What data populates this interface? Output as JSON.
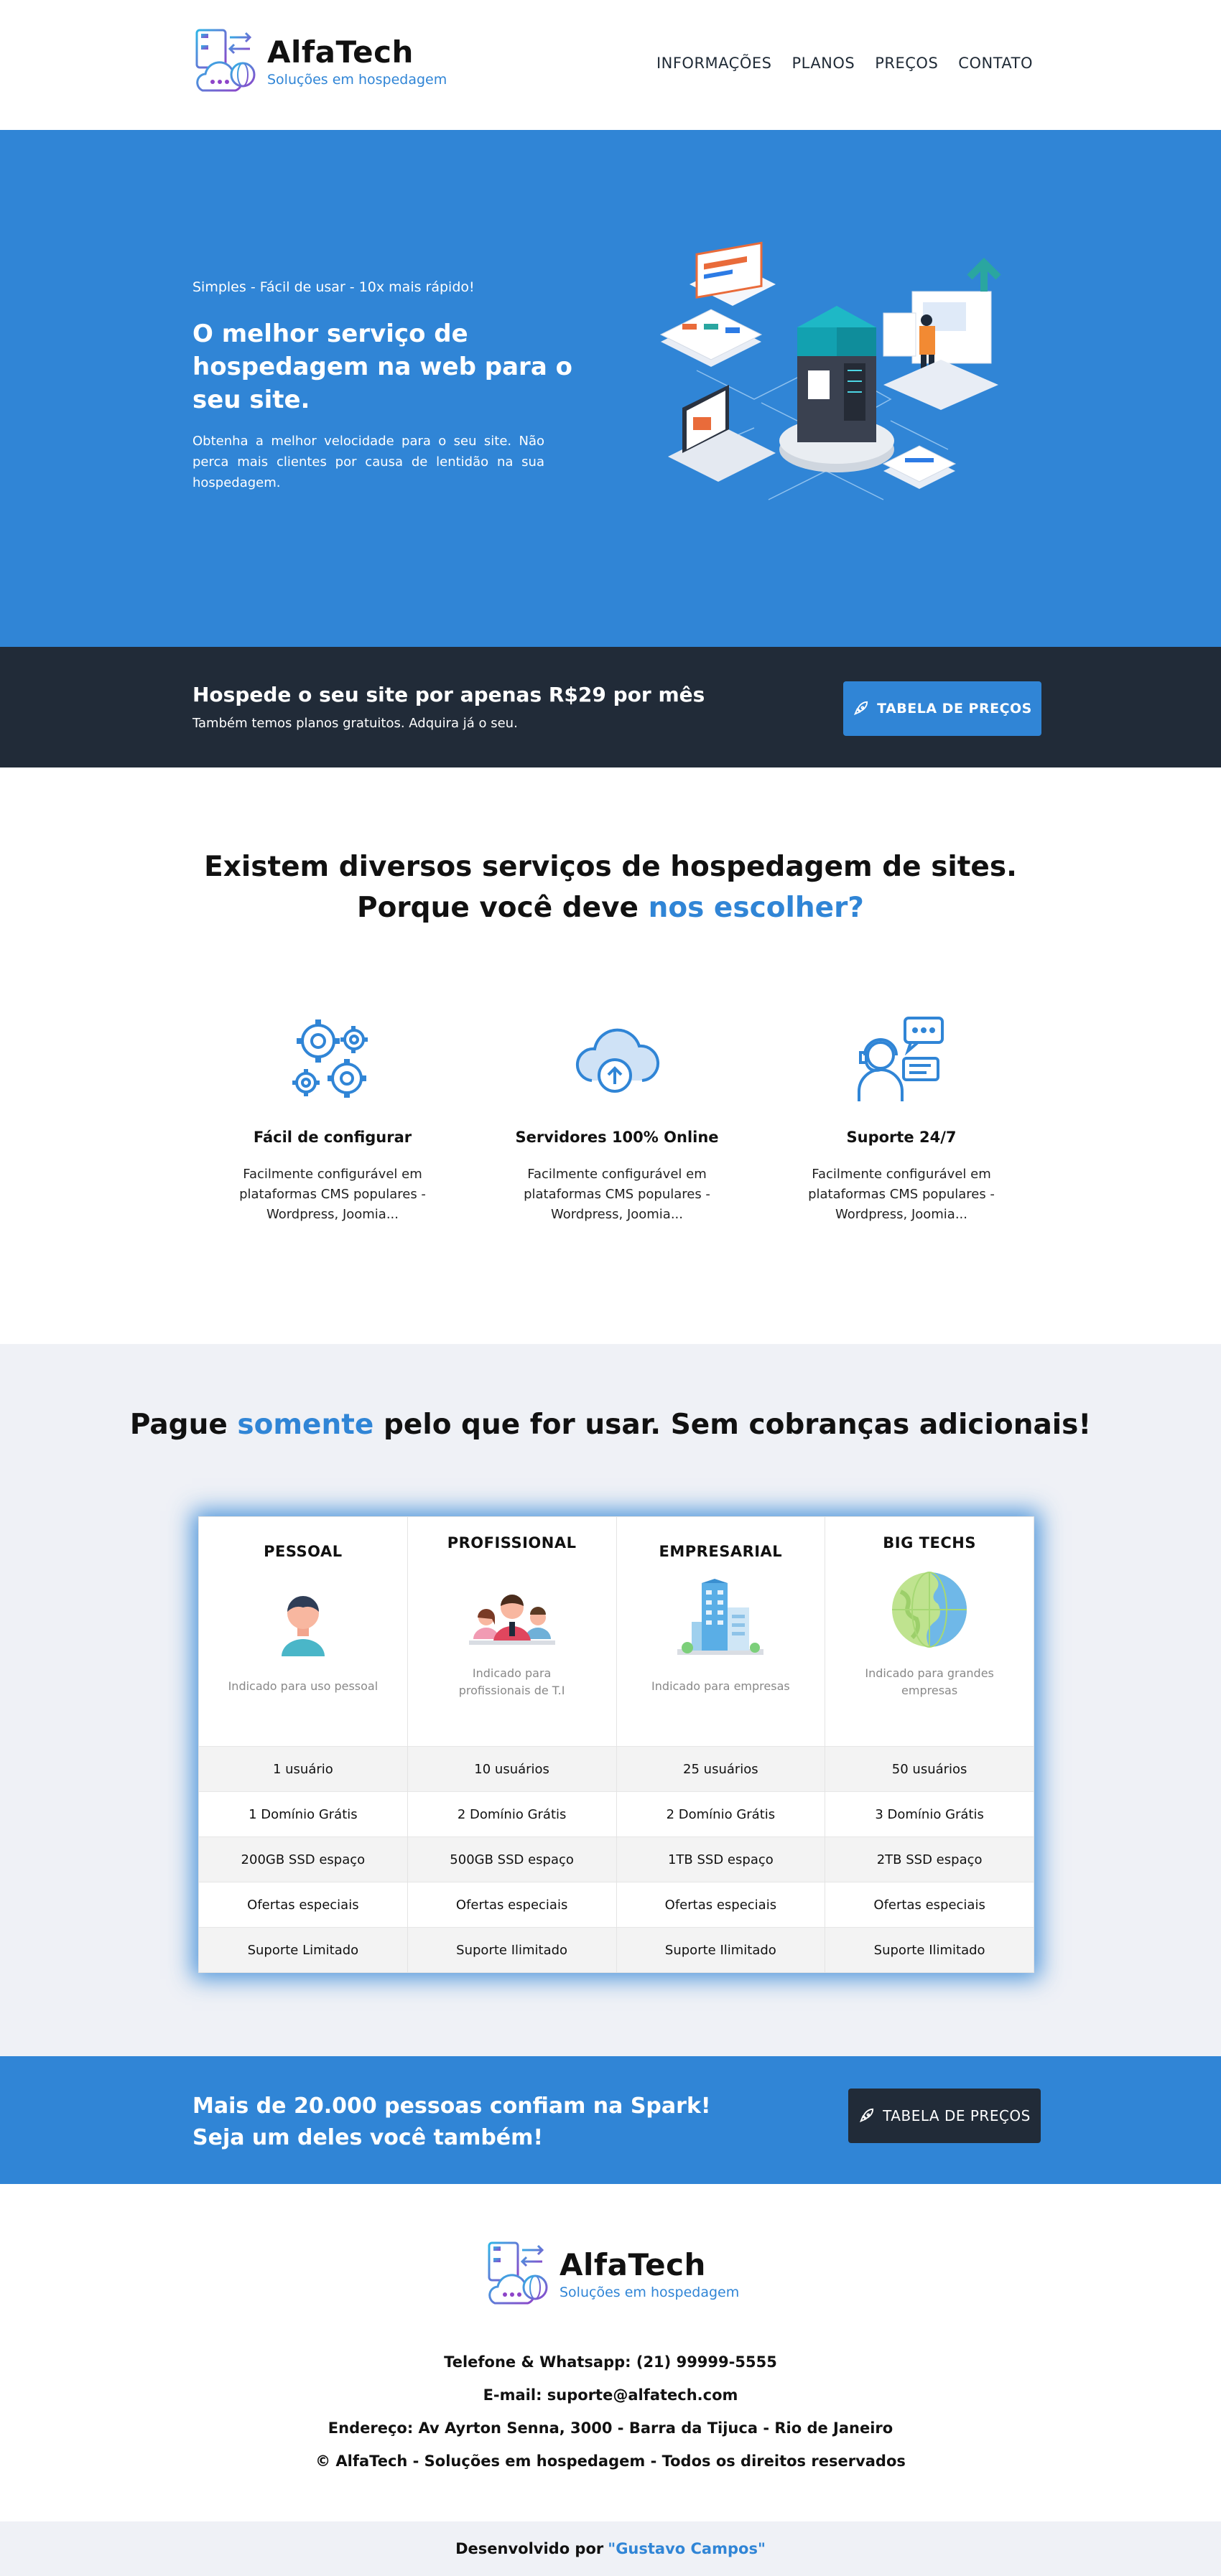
{
  "brand": {
    "name": "AlfaTech",
    "tagline": "Soluções em hospedagem"
  },
  "nav": [
    "INFORMAÇÕES",
    "PLANOS",
    "PREÇOS",
    "CONTATO"
  ],
  "hero": {
    "tagline": "Simples - Fácil de usar - 10x mais rápido!",
    "title": "O melhor serviço de hospedagem na web para o seu site.",
    "description": "Obtenha a melhor velocidade para o seu site. Não perca mais clientes por causa de lentidão na sua hospedagem."
  },
  "price_bar": {
    "title": "Hospede o seu site por apenas R$29 por mês",
    "subtitle": "Também temos planos gratuitos. Adquira já o seu.",
    "button": "TABELA DE PREÇOS"
  },
  "why": {
    "line1": "Existem diversos serviços de hospedagem de sites.",
    "line2_prefix": "Porque você deve ",
    "line2_highlight": "nos escolher?"
  },
  "features": [
    {
      "icon": "gears-icon",
      "title": "Fácil de configurar",
      "description": "Facilmente configurável em plataformas CMS populares - Wordpress, Joomia..."
    },
    {
      "icon": "cloud-upload-icon",
      "title": "Servidores 100% Online",
      "description": "Facilmente configurável em plataformas CMS populares - Wordpress, Joomia..."
    },
    {
      "icon": "support-agent-icon",
      "title": "Suporte 24/7",
      "description": "Facilmente configurável em plataformas CMS populares - Wordpress, Joomia..."
    }
  ],
  "plans_title": {
    "prefix": "Pague ",
    "highlight": "somente",
    "suffix": " pelo que for usar. Sem cobranças adicionais!"
  },
  "plans": [
    {
      "name": "PESSOAL",
      "icon": "person-avatar-icon",
      "description": "Indicado para uso pessoal",
      "features": [
        "1 usuário",
        "1 Domínio Grátis",
        "200GB SSD espaço",
        "Ofertas especiais",
        "Suporte Limitado"
      ]
    },
    {
      "name": "PROFISSIONAL",
      "icon": "team-icon",
      "description": "Indicado para profissionais de T.I",
      "features": [
        "10 usuários",
        "2 Domínio Grátis",
        "500GB SSD espaço",
        "Ofertas especiais",
        "Suporte Ilimitado"
      ]
    },
    {
      "name": "EMPRESARIAL",
      "icon": "building-icon",
      "description": "Indicado para empresas",
      "features": [
        "25 usuários",
        "2 Domínio Grátis",
        "1TB SSD espaço",
        "Ofertas especiais",
        "Suporte Ilimitado"
      ]
    },
    {
      "name": "BIG TECHS",
      "icon": "globe-icon",
      "description": "Indicado para grandes empresas",
      "features": [
        "50 usuários",
        "3 Domínio Grátis",
        "2TB SSD espaço",
        "Ofertas especiais",
        "Suporte Ilimitado"
      ]
    }
  ],
  "cta": {
    "line1": "Mais de 20.000 pessoas confiam na Spark!",
    "line2": "Seja um deles você também!",
    "button": "TABELA DE PREÇOS"
  },
  "footer": {
    "phone": "Telefone & Whatsapp: (21) 99999-5555",
    "email": "E-mail: suporte@alfatech.com",
    "address": "Endereço: Av Ayrton Senna, 3000 - Barra da Tijuca - Rio de Janeiro",
    "copyright": "© AlfaTech - Soluções em hospedagem - Todos os direitos reservados",
    "dev_prefix": "Desenvolvido por",
    "dev_author": "\"Gustavo Campos\""
  },
  "colors": {
    "primary": "#3085d6",
    "dark": "#212b38",
    "light_bg": "#eff1f6"
  }
}
